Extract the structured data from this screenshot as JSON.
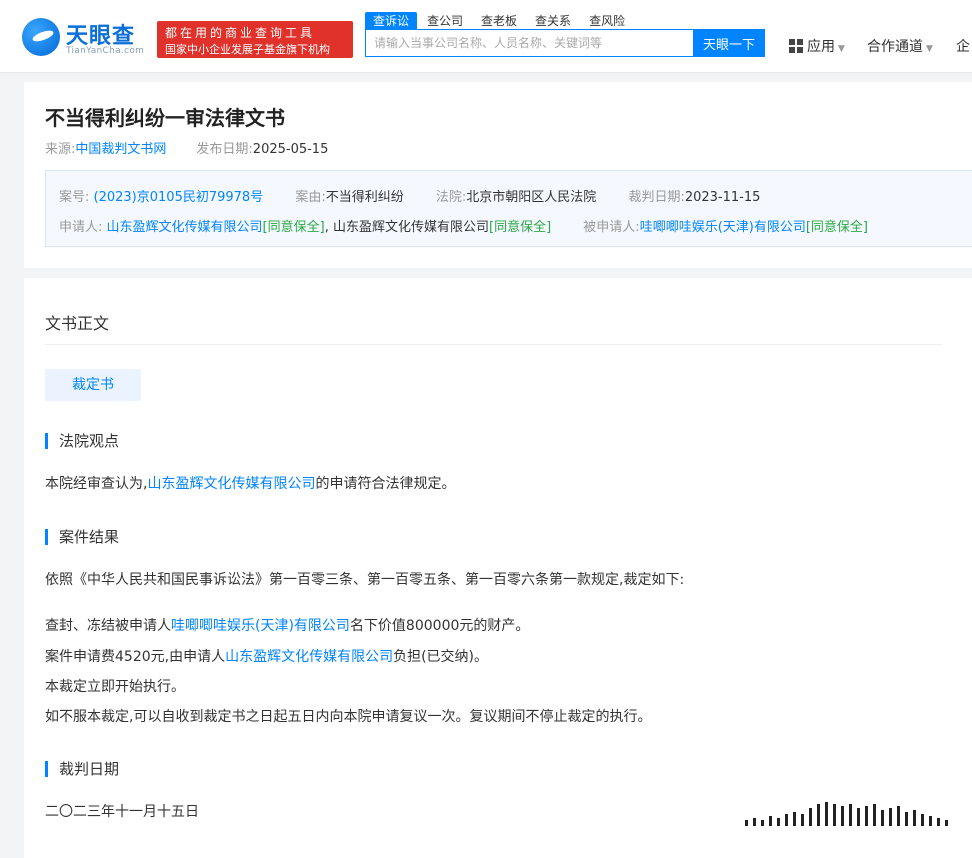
{
  "header": {
    "logo_text": "天眼查",
    "logo_sub": "TianYanCha.com",
    "slogan_line1": "都在用的商业查询工具",
    "slogan_line2": "国家中小企业发展子基金旗下机构",
    "tabs": [
      "查诉讼",
      "查公司",
      "查老板",
      "查关系",
      "查风险"
    ],
    "search_placeholder": "请输入当事公司名称、人员名称、关键词等",
    "search_button": "天眼一下",
    "nav_app": "应用",
    "nav_coop": "合作通道",
    "nav_more": "企"
  },
  "document": {
    "title": "不当得利纠纷一审法律文书",
    "source_label": "来源:",
    "source_value": "中国裁判文书网",
    "publish_label": "发布日期:",
    "publish_value": "2025-05-15",
    "case_no_label": "案号:",
    "case_no": "(2023)京0105民初79978号",
    "cause_label": "案由:",
    "cause": "不当得利纠纷",
    "court_label": "法院:",
    "court": "北京市朝阳区人民法院",
    "judge_date_label": "裁判日期:",
    "judge_date": "2023-11-15",
    "applicant_label": "申请人:",
    "applicant1": "山东盈辉文化传媒有限公司",
    "applicant1_tag": "[同意保全]",
    "separator": ",",
    "applicant2": "山东盈辉文化传媒有限公司",
    "applicant2_tag": "[同意保全]",
    "respondent_label": "被申请人:",
    "respondent": "哇唧唧哇娱乐(天津)有限公司",
    "respondent_tag": "[同意保全]"
  },
  "body": {
    "section_title": "文书正文",
    "doc_type": "裁定书",
    "court_view_heading": "法院观点",
    "court_view_prefix": "本院经审查认为,",
    "court_view_company": "山东盈辉文化传媒有限公司",
    "court_view_suffix": "的申请符合法律规定。",
    "result_heading": "案件结果",
    "result_intro": "依照《中华人民共和国民事诉讼法》第一百零三条、第一百零五条、第一百零六条第一款规定,裁定如下:",
    "result_1_prefix": "查封、冻结被申请人",
    "result_1_company": "哇唧唧哇娱乐(天津)有限公司",
    "result_1_suffix": "名下价值800000元的财产。",
    "result_2_prefix": "案件申请费4520元,由申请人",
    "result_2_company": "山东盈辉文化传媒有限公司",
    "result_2_suffix": "负担(已交纳)。",
    "result_3": "本裁定立即开始执行。",
    "result_4": "如不服本裁定,可以自收到裁定书之日起五日内向本院申请复议一次。复议期间不停止裁定的执行。",
    "date_heading": "裁判日期",
    "date_value": "二〇二三年十一月十五日"
  },
  "colors": {
    "accent": "#0084ff",
    "slogan_bg": "#e0312b",
    "tag_green": "#2aa845"
  }
}
